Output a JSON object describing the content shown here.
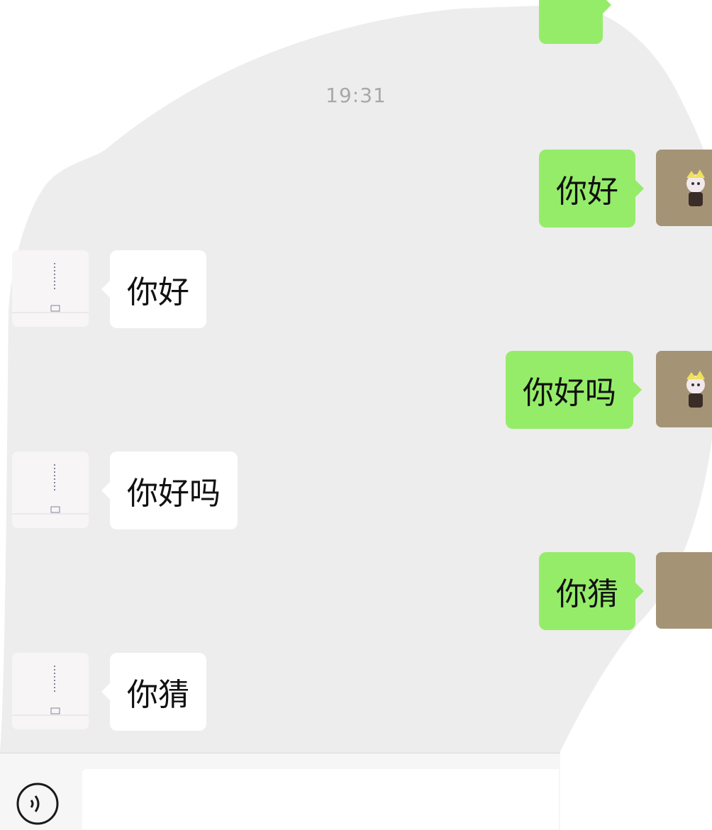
{
  "chat": {
    "timestamp": "19:31",
    "messages": [
      {
        "direction": "out",
        "text": "你好"
      },
      {
        "direction": "in",
        "text": "你好"
      },
      {
        "direction": "out",
        "text": "你好吗"
      },
      {
        "direction": "in",
        "text": "你好吗"
      },
      {
        "direction": "out",
        "text": "你猜"
      },
      {
        "direction": "in",
        "text": "你猜"
      }
    ]
  },
  "colors": {
    "chat_background": "#ededed",
    "outgoing_bubble": "#95ec69",
    "incoming_bubble": "#ffffff",
    "timestamp_text": "#a8a8a8"
  },
  "icons": {
    "my_avatar": "cartoon-character-avatar",
    "contact_avatar": "calligraphy-avatar",
    "voice_button": "voice-icon"
  }
}
